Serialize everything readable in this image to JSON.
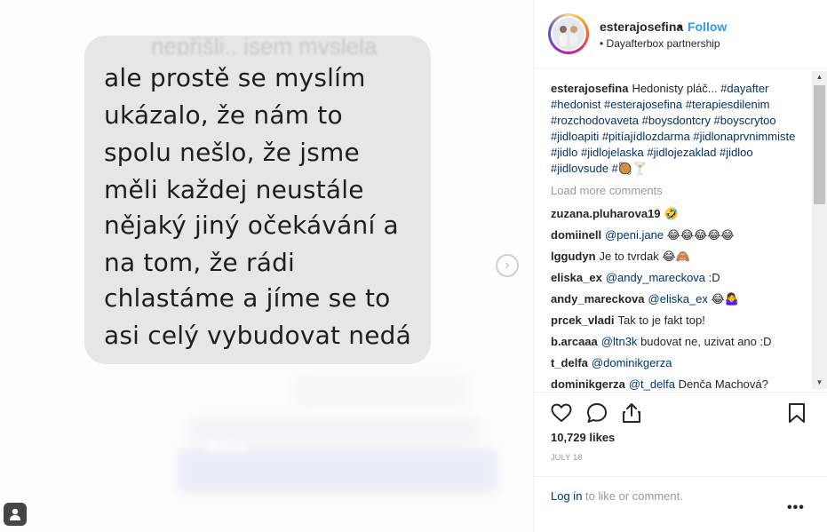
{
  "photo": {
    "ghost_text": "nepřišli.. jsem myslela",
    "message_lines": [
      "ale prostě se myslím",
      "ukázalo, že nám to",
      "spolu nešlo, že jsme",
      "měli každej neustále",
      "nějaký jiný očekávání a",
      "na tom, že rádi",
      "chlastáme a jíme se to",
      "asi celý vybudovat nedá"
    ],
    "blur_word": "ikala",
    "next_icon": "chevron-right-icon",
    "tag_icon": "user-tag-icon"
  },
  "header": {
    "username": "esterajosefina",
    "separator": "•",
    "follow_label": "Follow",
    "partnership": "• Dayafterbox partnership"
  },
  "caption": {
    "username": "esterajosefina",
    "text": "Hedonisty pláč...",
    "hashtags": "#dayafter #hedonist #esterajosefina #terapiesdilenim #rozchodovaveta #boysdontcry #boyscrytoo #jidloapiti #pitíajídlozdarma #jidlonaprvnimmiste #jidlo #jidlojelaska #jidlojezaklad #jidloo #jidlovsude #",
    "emoji": "🥘🍸"
  },
  "load_more_label": "Load more comments",
  "comments": [
    {
      "user": "zuzana.pluharova19",
      "mention": "",
      "text": "",
      "emoji": "🤣"
    },
    {
      "user": "domiinell",
      "mention": "@peni.jane",
      "text": "",
      "emoji": "😂😂😂😂😂"
    },
    {
      "user": "lggudyn",
      "mention": "",
      "text": "Je to tvrdak",
      "emoji": "😂🙈"
    },
    {
      "user": "eliska_ex",
      "mention": "@andy_mareckova",
      "text": ":D",
      "emoji": ""
    },
    {
      "user": "andy_mareckova",
      "mention": "@eliska_ex",
      "text": "",
      "emoji": "😂🤷‍♀"
    },
    {
      "user": "prcek_vladi",
      "mention": "",
      "text": "Tak to je fakt top!",
      "emoji": ""
    },
    {
      "user": "b.arcaaa",
      "mention": "@ltn3k",
      "text": "budovat ne, uzivat ano :D",
      "emoji": ""
    },
    {
      "user": "t_delfa",
      "mention": "@dominikgerza",
      "text": "",
      "emoji": ""
    },
    {
      "user": "dominikgerza",
      "mention": "@t_delfa",
      "text": "Denča Machová?",
      "emoji": ""
    }
  ],
  "actions": {
    "like_icon": "heart-icon",
    "comment_icon": "comment-icon",
    "share_icon": "share-icon",
    "save_icon": "bookmark-icon"
  },
  "likes": "10,729 likes",
  "date": "JULY 18",
  "login": {
    "link": "Log in",
    "rest": " to like or comment."
  },
  "more_label": "•••",
  "colors": {
    "link": "#003569",
    "follow": "#3897f0",
    "muted": "#999999",
    "text": "#262626"
  }
}
